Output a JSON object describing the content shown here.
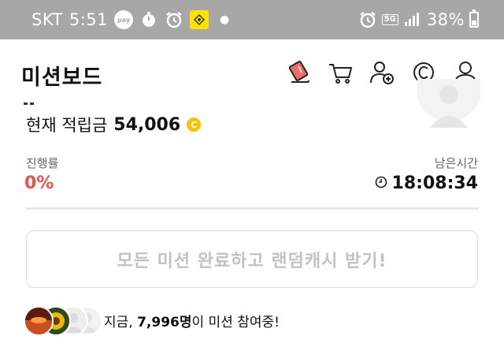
{
  "status_bar": {
    "carrier": "SKT",
    "time": "5:51",
    "pay_label": "pay",
    "network": "5G",
    "battery": "38%",
    "battery_level": 0.38,
    "icons": [
      "pay-icon",
      "timer-icon",
      "alarm-icon",
      "app-icon",
      "alarm-icon",
      "signal-icon",
      "battery-icon"
    ]
  },
  "header": {
    "title": "미션보드",
    "icons": [
      "mission-card-icon",
      "cart-icon",
      "add-friend-icon",
      "cash-icon",
      "profile-icon"
    ]
  },
  "balance": {
    "label": "현재 적립금",
    "value": "54,006",
    "coin_symbol": "C"
  },
  "progress": {
    "label": "진행률",
    "value": "0%",
    "color": "#ef4f4f"
  },
  "remaining_time": {
    "label": "남은시간",
    "value": "18:08:34"
  },
  "complete_button": {
    "label": "모든 미션 완료하고 랜덤캐시 받기!"
  },
  "participants": {
    "prefix": "지금, ",
    "count": "7,996명",
    "suffix": "이 미션 참여중!"
  },
  "colors": {
    "status_bar_bg": "#a7a7a7",
    "accent_red": "#ef4f4f",
    "coin_yellow": "#f5c400"
  }
}
